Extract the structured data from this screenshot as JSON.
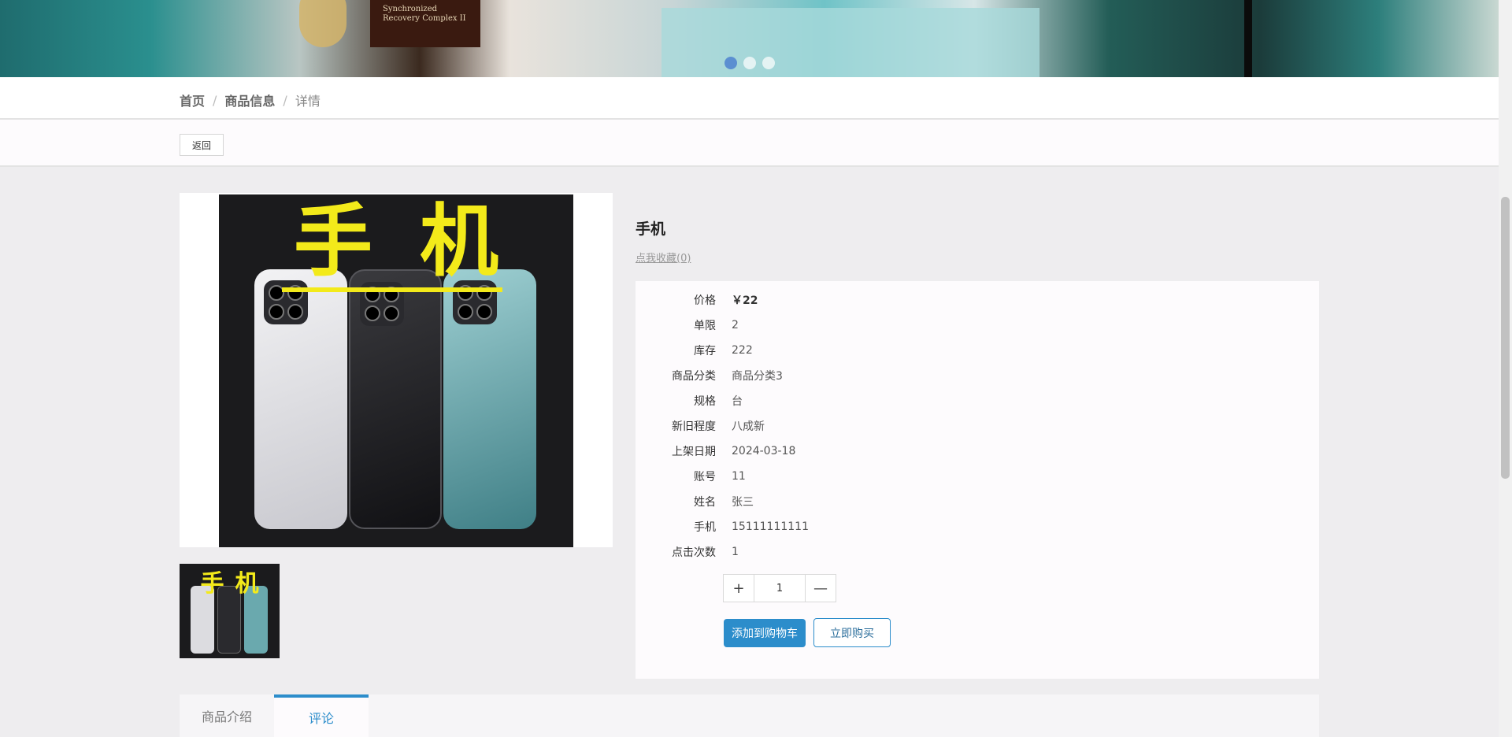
{
  "banner": {
    "caption_lines": [
      "Synchronized",
      "Recovery Complex II"
    ],
    "slide_count": 3,
    "active_slide": 1
  },
  "breadcrumb": {
    "home": "首页",
    "separator": "/",
    "list": "商品信息",
    "current": "详情"
  },
  "back_label": "返回",
  "product": {
    "image_text": "手机",
    "image_text_left": "手",
    "image_text_right": "机",
    "title": "手机",
    "favorite_label": "点我收藏(0)",
    "attributes": [
      {
        "key": "价格",
        "value": "￥22"
      },
      {
        "key": "单限",
        "value": "2"
      },
      {
        "key": "库存",
        "value": "222"
      },
      {
        "key": "商品分类",
        "value": "商品分类3"
      },
      {
        "key": "规格",
        "value": "台"
      },
      {
        "key": "新旧程度",
        "value": "八成新"
      },
      {
        "key": "上架日期",
        "value": "2024-03-18"
      },
      {
        "key": "账号",
        "value": "11"
      },
      {
        "key": "姓名",
        "value": "张三"
      },
      {
        "key": "手机",
        "value": "15111111111"
      },
      {
        "key": "点击次数",
        "value": "1"
      }
    ],
    "quantity": {
      "plus": "+",
      "value": "1",
      "minus": "—"
    },
    "add_to_cart": "添加到购物车",
    "buy_now": "立即购买"
  },
  "tabs": [
    {
      "label": "商品介绍",
      "active": false
    },
    {
      "label": "评论",
      "active": true
    }
  ],
  "colors": {
    "accent": "#2c8dcb",
    "highlight_yellow": "#f3ea1a"
  },
  "icons": {
    "plus": "plus-icon",
    "minus": "minus-icon"
  }
}
